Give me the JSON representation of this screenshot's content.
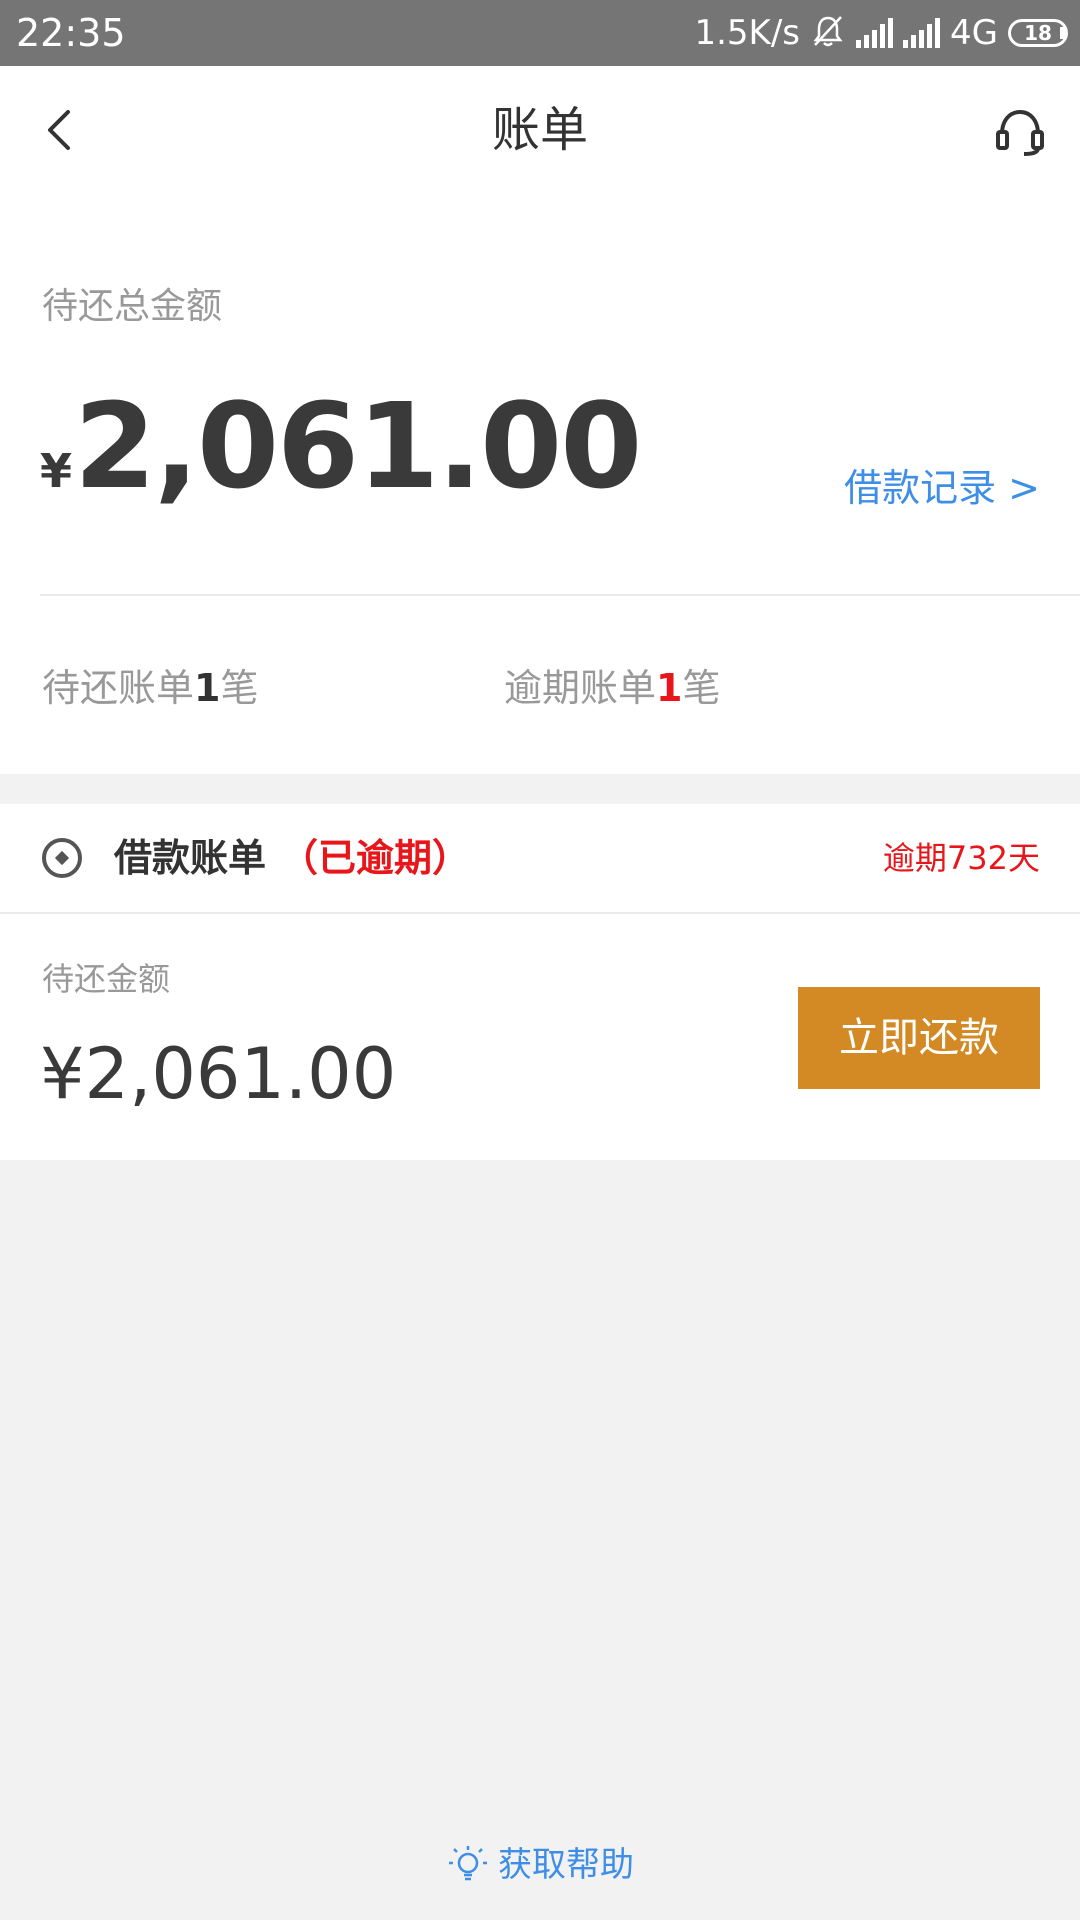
{
  "status_bar": {
    "time": "22:35",
    "net_speed": "1.5K/s",
    "network_type": "4G",
    "battery_level": "18",
    "icons": [
      "bell-muted-icon",
      "signal-icon",
      "signal-icon",
      "battery-icon"
    ]
  },
  "header": {
    "title": "账单",
    "back_icon": "chevron-left-icon",
    "support_icon": "headset-icon"
  },
  "summary": {
    "label": "待还总金额",
    "currency_symbol": "¥",
    "total_amount": "2,061.00",
    "loan_record_link": "借款记录 >",
    "pending_prefix": "待还账单",
    "pending_count": "1",
    "pending_suffix": "笔",
    "overdue_prefix": "逾期账单",
    "overdue_count": "1",
    "overdue_suffix": "笔"
  },
  "bill": {
    "title": "借款账单",
    "status_tag": "（已逾期）",
    "overdue_days": "逾期732天",
    "amount_label": "待还金额",
    "amount": "¥2,061.00",
    "pay_button": "立即还款"
  },
  "help": {
    "label": "获取帮助",
    "icon": "lightbulb-icon"
  },
  "colors": {
    "status_bar": "#757575",
    "link_blue": "#3e8ee8",
    "alert_red": "#e8161b",
    "pay_button": "#d48a24",
    "background": "#f2f2f2"
  }
}
